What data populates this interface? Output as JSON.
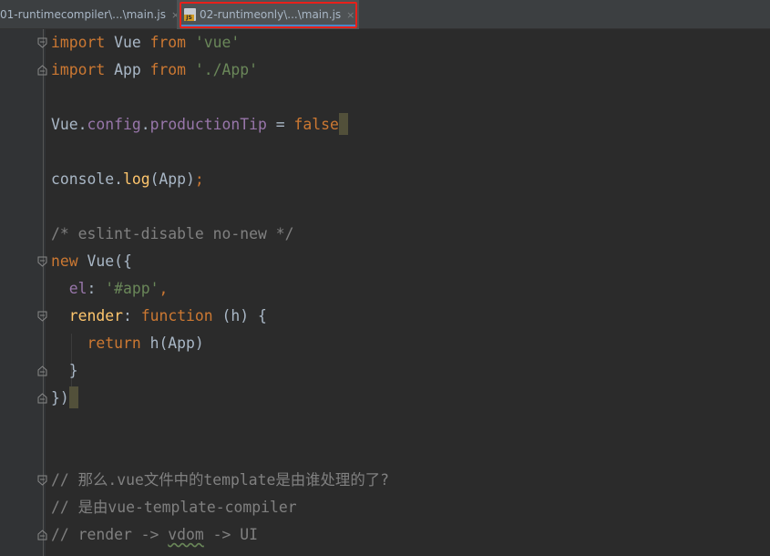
{
  "tabs": [
    {
      "label": "01-runtimecompiler\\...\\main.js",
      "active": false,
      "close": "×"
    },
    {
      "label": "02-runtimeonly\\...\\main.js",
      "active": true,
      "close": "×",
      "icon": "js-file-icon",
      "icon_badge": "JS"
    }
  ],
  "colors": {
    "keyword": "#cc7832",
    "string": "#6a8759",
    "property": "#9876aa",
    "function": "#ffc66d",
    "comment": "#808080",
    "text": "#a9b7c6",
    "highlight_box": "#e8201a"
  },
  "code": {
    "l1": {
      "kw1": "import",
      "t1": " Vue ",
      "kw2": "from",
      "s": " 'vue'"
    },
    "l2": {
      "kw1": "import",
      "t1": " App ",
      "kw2": "from",
      "s": " './App'"
    },
    "l4": {
      "t1": "Vue.",
      "p1": "config",
      "t2": ".",
      "p2": "productionTip",
      "t3": " = ",
      "kw": "false"
    },
    "l6": {
      "t1": "console.",
      "f": "log",
      "t2": "(App)",
      "kw": ";"
    },
    "l8": {
      "c": "/* eslint-disable no-new */"
    },
    "l9": {
      "kw": "new",
      "t1": " Vue({"
    },
    "l10": {
      "p": "el",
      "t1": ": ",
      "s": "'#app'",
      "kw": ","
    },
    "l11": {
      "f": "render",
      "t1": ": ",
      "kw": "function",
      "t2": " (h) {"
    },
    "l12": {
      "kw": "return",
      "t1": " h(App)"
    },
    "l13": {
      "t1": "}"
    },
    "l14": {
      "t1": "})"
    },
    "l18": {
      "c": "// 那么.vue文件中的template是由谁处理的了?"
    },
    "l19": {
      "c": "// 是由vue-template-compiler"
    },
    "l20": {
      "c1": "// render -> ",
      "c2": "vdom",
      "c3": " -> UI"
    }
  }
}
